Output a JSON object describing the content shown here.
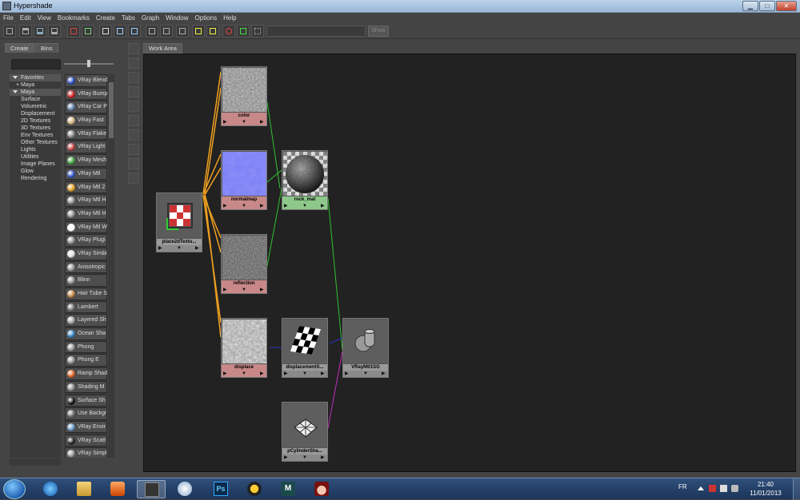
{
  "window": {
    "title": "Hypershade",
    "minimize": "▁",
    "maximize": "□",
    "close": "✕"
  },
  "menu": [
    "File",
    "Edit",
    "View",
    "Bookmarks",
    "Create",
    "Tabs",
    "Graph",
    "Window",
    "Options",
    "Help"
  ],
  "toolbar": {
    "show_label": "Show",
    "search_value": ""
  },
  "left_panel": {
    "tabs": [
      "Create",
      "Bins"
    ],
    "categories": [
      {
        "label": "Favorites",
        "type": "hdr",
        "expanded": true
      },
      {
        "label": "+ Maya",
        "type": "sub"
      },
      {
        "label": "Maya",
        "type": "hdr",
        "expanded": true
      },
      {
        "label": "Surface",
        "type": "item"
      },
      {
        "label": "Volumetric",
        "type": "item"
      },
      {
        "label": "Displacement",
        "type": "item"
      },
      {
        "label": "2D Textures",
        "type": "item"
      },
      {
        "label": "3D Textures",
        "type": "item"
      },
      {
        "label": "Env Textures",
        "type": "item"
      },
      {
        "label": "Other Textures",
        "type": "item"
      },
      {
        "label": "Lights",
        "type": "item"
      },
      {
        "label": "Utilities",
        "type": "item"
      },
      {
        "label": "Image Planes",
        "type": "item"
      },
      {
        "label": "Glow",
        "type": "item"
      },
      {
        "label": "Rendering",
        "type": "item"
      }
    ],
    "nodes": [
      {
        "label": "VRay Blend",
        "color": "#2a4bbf"
      },
      {
        "label": "VRay Bump",
        "color": "#c82020"
      },
      {
        "label": "VRay Car P",
        "color": "#5a7aa0"
      },
      {
        "label": "VRay Fast",
        "color": "#d0b080"
      },
      {
        "label": "VRay Flake",
        "color": "#888888"
      },
      {
        "label": "VRay Light",
        "color": "#c04040"
      },
      {
        "label": "VRay Mesh",
        "color": "#40a040"
      },
      {
        "label": "VRay Mtl",
        "color": "#3050c0"
      },
      {
        "label": "VRay Mtl 2",
        "color": "#e0a020"
      },
      {
        "label": "VRay Mtl H",
        "color": "#909090"
      },
      {
        "label": "VRay Mtl H",
        "color": "#909090"
      },
      {
        "label": "VRay Mtl W",
        "color": "#ffffff"
      },
      {
        "label": "VRay Plugi",
        "color": "#909090"
      },
      {
        "label": "VRay Simbi",
        "color": "#dddddd"
      },
      {
        "label": "Anisotropic",
        "color": "#909090"
      },
      {
        "label": "Blinn",
        "color": "#909090"
      },
      {
        "label": "Hair Tube S",
        "color": "#c08040"
      },
      {
        "label": "Lambert",
        "color": "#707070"
      },
      {
        "label": "Layered Sh",
        "color": "#a0a0a0"
      },
      {
        "label": "Ocean Sha",
        "color": "#3080c0"
      },
      {
        "label": "Phong",
        "color": "#909090"
      },
      {
        "label": "Phong E",
        "color": "#909090"
      },
      {
        "label": "Ramp Shad",
        "color": "#e06020"
      },
      {
        "label": "Shading M",
        "color": "#888888"
      },
      {
        "label": "Surface Sh",
        "color": "#101010"
      },
      {
        "label": "Use Backgr",
        "color": "#707070"
      },
      {
        "label": "VRay Envir",
        "color": "#6090c0"
      },
      {
        "label": "VRay Scatt",
        "color": "#202020"
      },
      {
        "label": "VRay Simpl",
        "color": "#909090"
      }
    ]
  },
  "work_area": {
    "tab_label": "Work Area",
    "nodes": {
      "place2d": {
        "label": "place2dTextu..."
      },
      "color": {
        "label": "color"
      },
      "normalmap": {
        "label": "normalmap"
      },
      "reflection": {
        "label": "reflection"
      },
      "displace": {
        "label": "displace"
      },
      "rock_mat": {
        "label": "rock_mat"
      },
      "displacementS": {
        "label": "displacementS..."
      },
      "vraymtl1sg": {
        "label": "VRayMtl1SG"
      },
      "pcylinder": {
        "label": "pCylinderSha..."
      }
    },
    "port_glyph": "▶",
    "menu_glyph": "▼"
  },
  "taskbar": {
    "lang": "FR",
    "time": "21:40",
    "date": "11/01/2013",
    "apps": [
      {
        "name": "internet-explorer-icon"
      },
      {
        "name": "file-explorer-icon"
      },
      {
        "name": "media-player-icon"
      },
      {
        "name": "hypershade-app-icon",
        "active": true
      },
      {
        "name": "paint-icon"
      },
      {
        "name": "photoshop-icon",
        "label": "Ps"
      },
      {
        "name": "nuke-icon"
      },
      {
        "name": "maya-icon",
        "label": "M"
      },
      {
        "name": "character-app-icon"
      }
    ]
  },
  "colors": {
    "link_orange": "#f0a020",
    "link_green": "#30c030",
    "link_blue": "#3030c0",
    "link_purple": "#c030c0",
    "texture_bar": "#c88888",
    "material_bar": "#8dc88a"
  }
}
